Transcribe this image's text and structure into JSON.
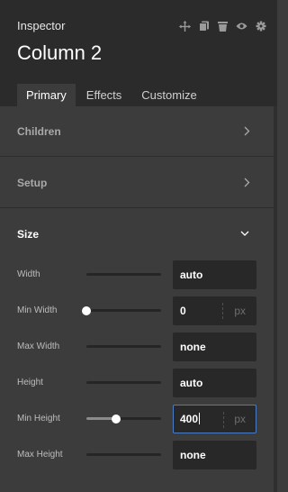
{
  "inspector": {
    "title": "Inspector",
    "component_name": "Column 2",
    "toolbar_icons": [
      "move-icon",
      "duplicate-icon",
      "delete-icon",
      "visibility-icon",
      "settings-icon"
    ]
  },
  "tabs": [
    {
      "label": "Primary",
      "active": true
    },
    {
      "label": "Effects",
      "active": false
    },
    {
      "label": "Customize",
      "active": false
    }
  ],
  "sections": {
    "children": {
      "label": "Children",
      "expanded": false
    },
    "setup": {
      "label": "Setup",
      "expanded": false
    },
    "size": {
      "label": "Size",
      "expanded": true
    }
  },
  "size_properties": {
    "width": {
      "label": "Width",
      "value": "auto",
      "unit": "",
      "slider_percent": 0
    },
    "min_width": {
      "label": "Min Width",
      "value": "0",
      "unit": "px",
      "slider_percent": 0
    },
    "max_width": {
      "label": "Max Width",
      "value": "none",
      "unit": "",
      "slider_percent": 0
    },
    "height": {
      "label": "Height",
      "value": "auto",
      "unit": "",
      "slider_percent": 0
    },
    "min_height": {
      "label": "Min Height",
      "value": "400",
      "unit": "px",
      "slider_percent": 40,
      "focused": true
    },
    "max_height": {
      "label": "Max Height",
      "value": "none",
      "unit": "",
      "slider_percent": 0
    }
  },
  "colors": {
    "header_bg": "#2b2b2b",
    "panel_bg": "#3c3c3c",
    "field_bg": "#282828",
    "focus_border": "#4a7cc5"
  }
}
